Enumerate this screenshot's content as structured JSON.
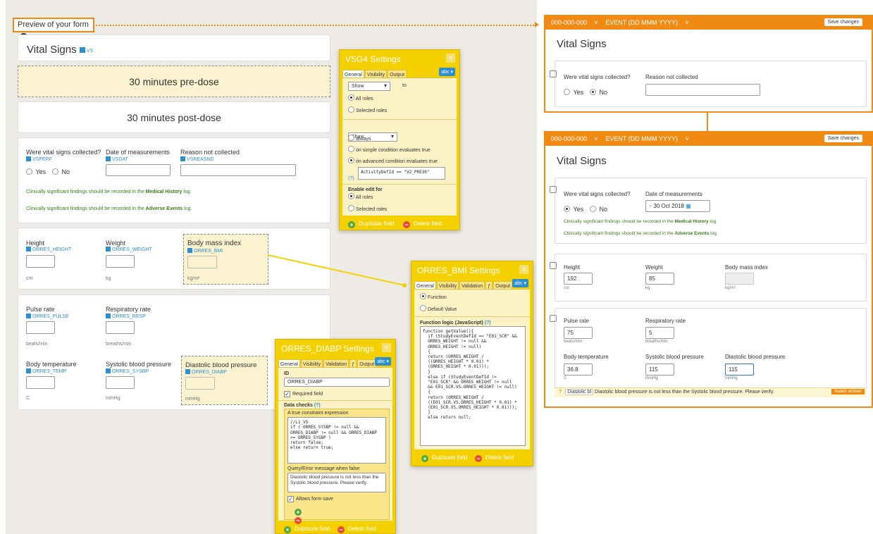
{
  "left": {
    "preview_title": "Preview of your form",
    "help_glyph": "?",
    "form_title": "Vital Signs",
    "form_var": "VS",
    "sections": {
      "pre": "30 minutes pre-dose",
      "post": "30 minutes post-dose"
    },
    "collected": {
      "label": "Were vital signs collected?",
      "var": "VSPERF",
      "yes": "Yes",
      "no": "No"
    },
    "date": {
      "label": "Date of measurements",
      "var": "VSDAT"
    },
    "reason": {
      "label": "Reason not collected",
      "var": "VSREASND"
    },
    "note_medical": {
      "pre": "Clinically significant findings should be recorded in the ",
      "link": "Medical History",
      "post": " log."
    },
    "note_adverse": {
      "pre": "Clinically significant findings should be recorded in the ",
      "link": "Adverse Events",
      "post": " log."
    },
    "height": {
      "label": "Height",
      "var": "ORRES_HEIGHT",
      "unit": "cm"
    },
    "weight": {
      "label": "Weight",
      "var": "ORRES_WEIGHT",
      "unit": "kg"
    },
    "bmi": {
      "label": "Body mass index",
      "var": "ORRES_BMI",
      "unit": "kg/m²"
    },
    "pulse": {
      "label": "Pulse rate",
      "var": "ORRES_PULSE",
      "unit": "beats/min"
    },
    "resp": {
      "label": "Respiratory rate",
      "var": "ORRES_RESP",
      "unit": "breaths/min"
    },
    "temp": {
      "label": "Body temperature",
      "var": "ORRES_TEMP",
      "unit": "C"
    },
    "sysbp": {
      "label": "Systolic blood pressure",
      "var": "ORRES_SYSBP",
      "unit": "mmHg"
    },
    "diabp": {
      "label": "Diastolic blood pressure",
      "var": "ORRES_DIABP",
      "unit": "mmHg"
    }
  },
  "vsg4": {
    "title": "VSG4 Settings",
    "close": "×",
    "tabs": [
      "General",
      "Visibility",
      "Output"
    ],
    "abc": "abc ▾",
    "show1": "Show",
    "to": "to",
    "all_roles": "All roles",
    "selected_roles": "Selected roles",
    "show2": "Show",
    "always": "always",
    "simple": "on simple condition evaluates true",
    "advanced": "on advanced condition evaluates true",
    "expr": "ActivityDefId == \"V2_PRE30\"",
    "q": "(?)",
    "enable_edit": "Enable edit for",
    "all_roles2": "All roles",
    "selected_roles2": "Selected roles",
    "duplicate": "Duplicate field",
    "delete": "Delete field"
  },
  "bmi_pop": {
    "title": "ORRES_BMI Settings",
    "close": "×",
    "tabs": [
      "General",
      "Visibility",
      "Validation",
      "ƒ",
      "Output"
    ],
    "abc": "abc ▾",
    "function": "Function",
    "default_value": "Default Value",
    "logic_label": "Function logic (JavaScript)",
    "q": "(?)",
    "code": "function getValue(){\n  if (StudyEventDefId == \"E01_SCR\" &&\n  ORRES_WEIGHT != null &&\n  ORRES_HEIGHT != null)\n  {\n  return (ORRES_WEIGHT /\n  ((ORRES_HEIGHT * 0.01) *\n  (ORRES_HEIGHT * 0.01)));\n  }\n  else if (StudyEventDefId !=\n  \"E01_SCR\" && ORRES_WEIGHT != null\n  && E01_SCR.VS.ORRES_HEIGHT != null)\n  {\n  return (ORRES_WEIGHT /\n  ((E01_SCR.VS.ORRES_HEIGHT * 0.01) *\n  (E01_SCR.VS.ORRES_HEIGHT * 0.01)));\n  }\n  else return null;\n\n\n\n\n\n}",
    "duplicate": "Duplicate field",
    "delete": "Delete field"
  },
  "diabp_pop": {
    "title": "ORRES_DIABP Settings",
    "close": "×",
    "tabs": [
      "General",
      "Visibility",
      "Validation",
      "ƒ",
      "Output"
    ],
    "abc": "abc ▾",
    "id_label": "ID",
    "id_value": "ORRES_DIABP",
    "required": "Required field",
    "checks_label": "Data checks",
    "q": "(?)",
    "constraint_label": "A true constraint expression",
    "code": "//L1_VS\nif ( ORRES_SYSBP != null &&\nORRES_DIABP != null && ORRES_DIABP\n>= ORRES_SYSBP )\nreturn false;\nelse return true;",
    "query_label": "Query/Error message when false",
    "query_text": "Diastolic blood pressure is not less than the Systolic blood pressure. Please verify.",
    "allows_save": "Allows form save",
    "duplicate": "Duplicate field",
    "delete": "Delete field"
  },
  "right1": {
    "subject": "000-000-000",
    "event": "EVENT (DD MMM YYYY)",
    "save": "Save changes",
    "title": "Vital Signs",
    "collected": "Were vital signs collected?",
    "reason": "Reason not collected",
    "yes": "Yes",
    "no": "No"
  },
  "right2": {
    "subject": "000-000-000",
    "event": "EVENT (DD MMM YYYY)",
    "save": "Save changes",
    "title": "Vital Signs",
    "collected": "Were vital signs collected?",
    "date_label": "Date of measurements",
    "date_value": "30 Oct 2018",
    "yes": "Yes",
    "no": "No",
    "note_medical": {
      "pre": "Clinically significant findings should be recorded in the ",
      "link": "Medical History",
      "post": " log."
    },
    "note_adverse": {
      "pre": "Clinically significant findings should be recorded in the ",
      "link": "Adverse Events",
      "post": " log."
    },
    "height": {
      "label": "Height",
      "value": "192",
      "unit": "cm"
    },
    "weight": {
      "label": "Weight",
      "value": "85",
      "unit": "kg"
    },
    "bmi": {
      "label": "Body mass index",
      "unit": "kg/m²"
    },
    "pulse": {
      "label": "Pulse rate",
      "value": "75",
      "unit": "beats/min"
    },
    "resp": {
      "label": "Respiratory rate",
      "value": "5",
      "unit": "breaths/min"
    },
    "temp": {
      "label": "Body temperature",
      "value": "36.8",
      "unit": "C"
    },
    "sysbp": {
      "label": "Systolic blood pressure",
      "value": "115",
      "unit": "mmHg"
    },
    "diabp": {
      "label": "Diastolic blood pressure",
      "value": "115",
      "unit": "mmHg"
    },
    "query_q": "?",
    "query_field": "Diastolic bl",
    "query_text": "Diastolic blood pressure is not less than the Systolic blood pressure. Please verify.",
    "awaits": "Awaits answer"
  },
  "colors": {
    "accent": "#f08a13",
    "popup": "#f5d000",
    "link": "#2b8fd0",
    "note": "#3a7a1a"
  }
}
